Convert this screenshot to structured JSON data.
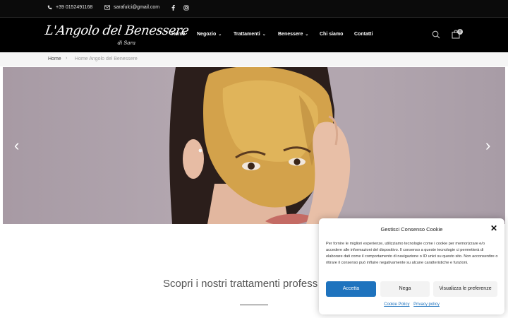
{
  "topbar": {
    "phone": "+39 0152491168",
    "email": "sarafulci@gmail.com",
    "phone_icon": "phone-icon",
    "email_icon": "envelope-icon",
    "social": [
      "facebook-icon",
      "instagram-icon"
    ]
  },
  "header": {
    "logo_text": "L'Angolo del Benessere",
    "logo_sub": "di Sara",
    "nav": [
      {
        "label": "Home",
        "has_dropdown": false
      },
      {
        "label": "Negozio",
        "has_dropdown": true
      },
      {
        "label": "Trattamenti",
        "has_dropdown": true
      },
      {
        "label": "Benessere",
        "has_dropdown": true
      },
      {
        "label": "Chi siamo",
        "has_dropdown": false
      },
      {
        "label": "Contatti",
        "has_dropdown": false
      }
    ],
    "search_icon": "search-icon",
    "cart_icon": "shopping-bag-icon",
    "cart_count": "0"
  },
  "breadcrumb": {
    "home": "Home",
    "current": "Home Angolo del Benessere"
  },
  "hero": {
    "prev_icon": "chevron-left-icon",
    "next_icon": "chevron-right-icon"
  },
  "section": {
    "heading": "Scopri i nostri trattamenti profess"
  },
  "consent": {
    "title": "Gestisci Consenso Cookie",
    "body": "Per fornire le migliori esperienze, utilizziamo tecnologie come i cookie per memorizzare e/o accedere alle informazioni del dispositivo. Il consenso a queste tecnologie ci permetterà di elaborare dati come il comportamento di navigazione o ID unici su questo sito. Non acconsentire o ritirare il consenso può influire negativamente su alcune caratteristiche e funzioni.",
    "accept": "Accetta",
    "deny": "Nega",
    "preferences": "Visualizza le preferenze",
    "cookie_policy": "Cookie Policy",
    "privacy_policy": "Privacy policy",
    "accent_color": "#1e73be"
  }
}
